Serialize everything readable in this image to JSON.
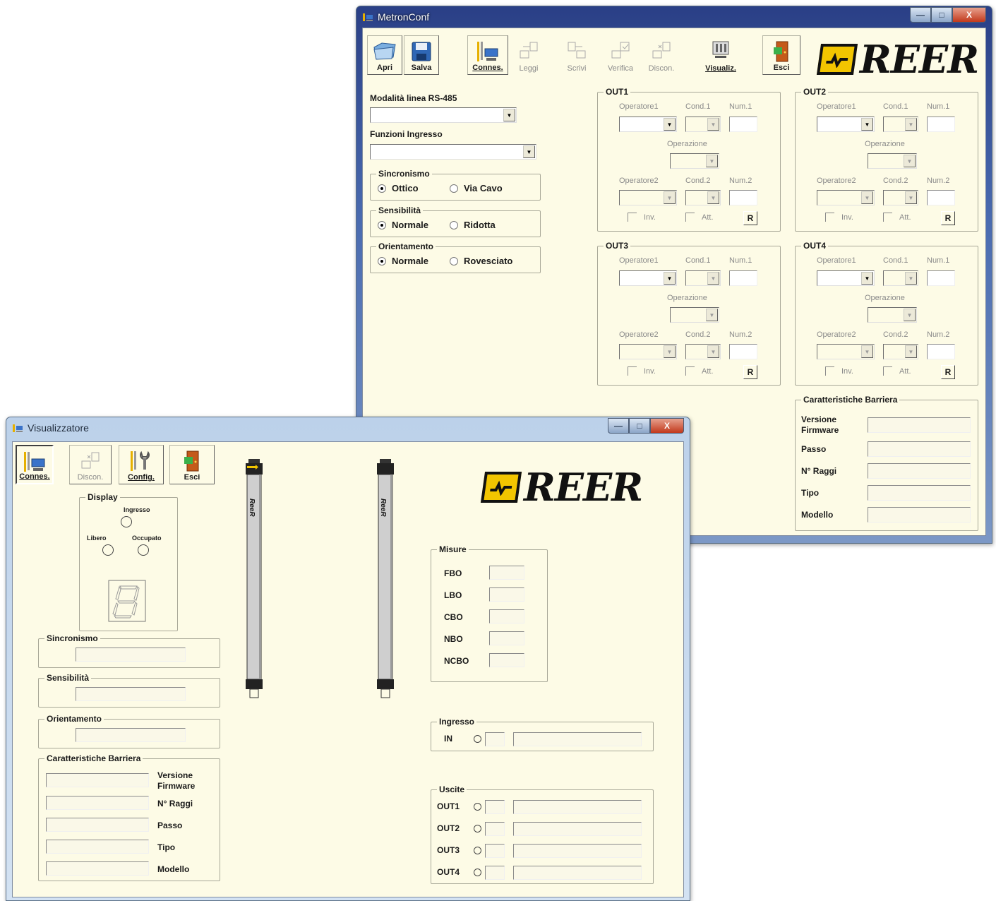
{
  "win1": {
    "title": "MetronConf",
    "controls": {
      "minimize": "—",
      "maximize": "□",
      "close": "X"
    },
    "toolbar": [
      {
        "label": "Apri",
        "icon": "folder-open-icon",
        "enabled": true
      },
      {
        "label": "Salva",
        "icon": "floppy-disk-icon",
        "enabled": true
      },
      {
        "label": "Connes.",
        "icon": "connect-icon",
        "enabled": true
      },
      {
        "label": "Leggi",
        "icon": "read-icon",
        "enabled": false
      },
      {
        "label": "Scrivi",
        "icon": "write-icon",
        "enabled": false
      },
      {
        "label": "Verifica",
        "icon": "verify-icon",
        "enabled": false
      },
      {
        "label": "Discon.",
        "icon": "disconnect-icon",
        "enabled": false
      },
      {
        "label": "Visualiz.",
        "icon": "display-icon",
        "enabled": true
      },
      {
        "label": "Esci",
        "icon": "exit-door-icon",
        "enabled": true
      }
    ],
    "logo": "REER",
    "rs485_label": "Modalità linea RS-485",
    "ingresso_label": "Funzioni Ingresso",
    "sincronismo": {
      "title": "Sincronismo",
      "opt1": "Ottico",
      "opt2": "Via Cavo"
    },
    "sensibilita": {
      "title": "Sensibilità",
      "opt1": "Normale",
      "opt2": "Ridotta"
    },
    "orientamento": {
      "title": "Orientamento",
      "opt1": "Normale",
      "opt2": "Rovesciato"
    },
    "out_labels": {
      "op1": "Operatore1",
      "cond1": "Cond.1",
      "num1": "Num.1",
      "operazione": "Operazione",
      "op2": "Operatore2",
      "cond2": "Cond.2",
      "num2": "Num.2",
      "inv": "Inv.",
      "att": "Att.",
      "r": "R"
    },
    "outs": [
      "OUT1",
      "OUT2",
      "OUT3",
      "OUT4"
    ],
    "caratteristiche": {
      "title": "Caratteristiche Barriera",
      "versione": "Versione",
      "firmware": "Firmware",
      "passo": "Passo",
      "raggi": "N° Raggi",
      "tipo": "Tipo",
      "modello": "Modello"
    }
  },
  "win2": {
    "title": "Visualizzatore",
    "toolbar": [
      {
        "label": "Connes.",
        "icon": "connect-icon",
        "enabled": true
      },
      {
        "label": "Discon.",
        "icon": "disconnect-icon",
        "enabled": false
      },
      {
        "label": "Config.",
        "icon": "config-tools-icon",
        "enabled": true
      },
      {
        "label": "Esci",
        "icon": "exit-door-icon",
        "enabled": true
      }
    ],
    "logo": "REER",
    "display": {
      "title": "Display",
      "ingresso": "Ingresso",
      "libero": "Libero",
      "occupato": "Occupato"
    },
    "sincronismo": "Sincronismo",
    "sensibilita": "Sensibilità",
    "orientamento": "Orientamento",
    "caratteristiche": {
      "title": "Caratteristiche Barriera",
      "versione": "Versione",
      "firmware": "Firmware",
      "raggi": "N° Raggi",
      "passo": "Passo",
      "tipo": "Tipo",
      "modello": "Modello"
    },
    "bar_logo": "ReeR",
    "misure": {
      "title": "Misure",
      "items": [
        "FBO",
        "LBO",
        "CBO",
        "NBO",
        "NCBO"
      ]
    },
    "ingresso": {
      "title": "Ingresso",
      "in": "IN"
    },
    "uscite": {
      "title": "Uscite",
      "items": [
        "OUT1",
        "OUT2",
        "OUT3",
        "OUT4"
      ]
    }
  },
  "colors": {
    "client_bg": "#fdfbe6",
    "logo_yellow": "#f2c500",
    "title_blue": "#2a3f86",
    "close_red": "#c2391c"
  }
}
